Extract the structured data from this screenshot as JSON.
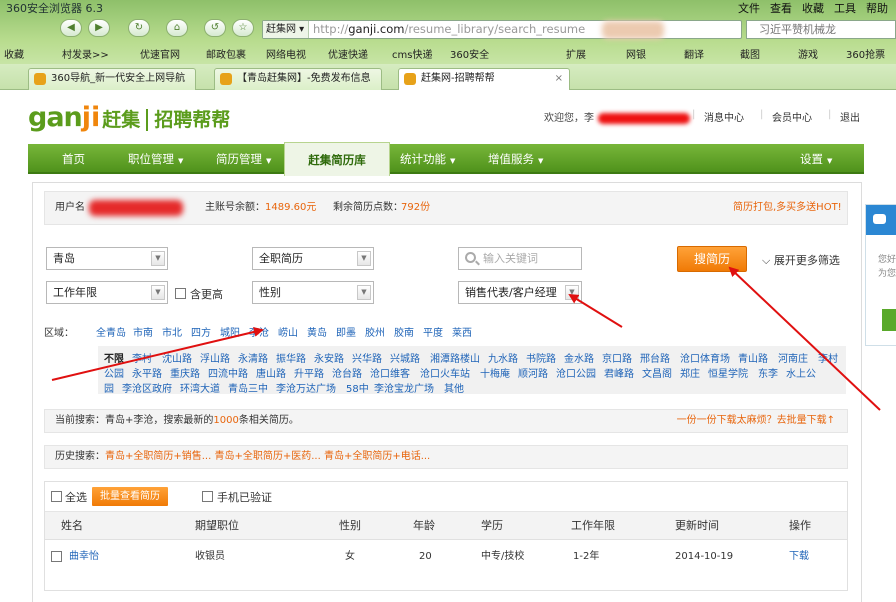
{
  "browser": {
    "title": "360安全浏览器 6.3",
    "menu": [
      "文件",
      "查看",
      "收藏",
      "工具",
      "帮助"
    ],
    "site_button": "赶集网",
    "url_prefix": "http://",
    "url_domain": "ganji.com",
    "url_path": "/resume_library/search_resume",
    "search_text": "习近平赞机械龙",
    "favorites": [
      "收藏",
      "村发录>>",
      "优速官网",
      "邮政包裹",
      "网络电视",
      "优速快递",
      "cms快递",
      "360安全",
      "扩展",
      "网银",
      "翻译",
      "截图",
      "游戏",
      "360抢票"
    ],
    "tabs": [
      {
        "label": "360导航_新一代安全上网导航"
      },
      {
        "label": "【青岛赶集网】-免费发布信息"
      },
      {
        "label": "赶集网-招聘帮帮"
      }
    ]
  },
  "header": {
    "logo_ganji": "gan",
    "logo_ji": "ji",
    "logo_cn": "赶集",
    "logo_sub": "招聘帮帮",
    "welcome": "欢迎您，",
    "welcome_user": "李",
    "links": [
      "消息中心",
      "会员中心",
      "退出"
    ]
  },
  "nav": {
    "items": [
      {
        "label": "首页",
        "arrow": ""
      },
      {
        "label": "职位管理",
        "arrow": "▼"
      },
      {
        "label": "简历管理",
        "arrow": "▼"
      },
      {
        "label": "赶集简历库",
        "arrow": ""
      },
      {
        "label": "统计功能",
        "arrow": "▼"
      },
      {
        "label": "增值服务",
        "arrow": "▼"
      },
      {
        "label": "设置",
        "arrow": "▼"
      }
    ]
  },
  "account": {
    "username_label": "用户名",
    "balance_label": "主账号余额：",
    "balance_value": "1489.60元",
    "points_label": "剩余简历点数：",
    "points_value": "792份",
    "promo": "简历打包,多买多送HOT!"
  },
  "filters": {
    "city": "青岛",
    "resume_type": "全职简历",
    "keyword_placeholder": "输入关键词",
    "work_years": "工作年限",
    "include_higher": "含更高",
    "gender": "性别",
    "position": "销售代表/客户经理",
    "search_button": "搜简历",
    "more_filters": "展开更多筛选"
  },
  "region": {
    "label": "区域：",
    "items": [
      "全青岛",
      "市南",
      "市北",
      "四方",
      "城阳",
      "李沧",
      "崂山",
      "黄岛",
      "即墨",
      "胶州",
      "胶南",
      "平度",
      "莱西"
    ]
  },
  "streets": {
    "row1": [
      "不限",
      "李村",
      "沈山路",
      "浮山路",
      "永清路",
      "振华路",
      "永安路",
      "兴华路",
      "兴城路",
      "湘潭路楼山",
      "九水路",
      "书院路",
      "金水路",
      "京口路",
      "邢台路",
      "沧口体育场",
      "青山路",
      "河南庄",
      "李村"
    ],
    "row2": [
      "公园",
      "永平路",
      "重庆路",
      "四流中路",
      "唐山路",
      "升平路",
      "沧台路",
      "沧口维客",
      "沧口火车站",
      "十梅庵",
      "顺河路",
      "沧口公园",
      "君峰路",
      "文昌阁",
      "郑庄",
      "恒星学院",
      "东李",
      "水上公"
    ],
    "row3": [
      "园",
      "李沧区政府",
      "环湾大道",
      "青岛三中",
      "李沧万达广场",
      "58中",
      "李沧宝龙广场",
      "其他"
    ]
  },
  "current_search": {
    "prefix": "当前搜索：青岛+李沧，搜索最新的",
    "count": "1000",
    "suffix": "条相关简历。",
    "batch_tip": "一份一份下载太麻烦？去批量下载↑"
  },
  "history": {
    "label": "历史搜索：",
    "items": "青岛+全职简历+销售... 青岛+全职简历+医药... 青岛+全职简历+电话..."
  },
  "table": {
    "select_all": "全选",
    "batch_view": "批量查看简历",
    "phone_verified": "手机已验证",
    "headers": [
      "姓名",
      "期望职位",
      "性别",
      "年龄",
      "学历",
      "工作年限",
      "更新时间",
      "操作"
    ],
    "rows": [
      {
        "name": "曲幸怡",
        "position": "收银员",
        "gender": "女",
        "age": "20",
        "education": "中专/技校",
        "years": "1-2年",
        "updated": "2014-10-19",
        "action": "下载"
      }
    ]
  },
  "side_widget": {
    "line1": "您好",
    "line2": "为您"
  },
  "colors": {
    "nav_green": "#5b9c1c",
    "accent_orange": "#f07a06",
    "link_blue": "#1f64b8",
    "annotation_red": "#e01010"
  }
}
